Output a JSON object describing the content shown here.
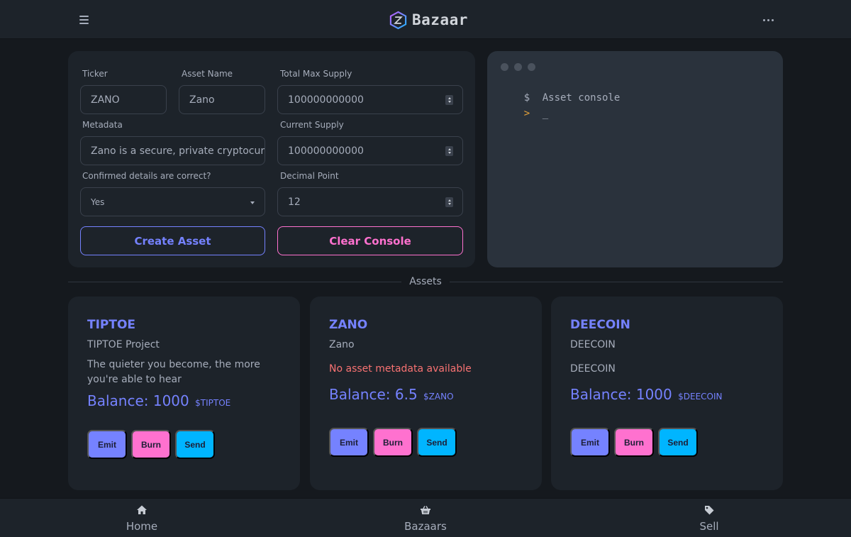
{
  "header": {
    "brand_title": "Bazaar",
    "menu_icon": "hamburger-icon",
    "more_icon": "ellipsis-icon",
    "logo_icon": "zano-hexagon-logo"
  },
  "form": {
    "ticker": {
      "label": "Ticker",
      "value": "ZANO"
    },
    "asset_name": {
      "label": "Asset Name",
      "value": "Zano"
    },
    "total_max_supply": {
      "label": "Total Max Supply",
      "value": "100000000000"
    },
    "metadata": {
      "label": "Metadata",
      "value": "Zano is a secure, private cryptocurrency"
    },
    "current_supply": {
      "label": "Current Supply",
      "value": "100000000000"
    },
    "confirmed": {
      "label": "Confirmed details are correct?",
      "value": "Yes"
    },
    "decimal_point": {
      "label": "Decimal Point",
      "value": "12"
    },
    "create_label": "Create Asset",
    "clear_label": "Clear Console"
  },
  "console": {
    "lines": [
      {
        "prefix": "$",
        "text": "Asset console",
        "prefix_color": "#a6adbb"
      },
      {
        "prefix": ">",
        "text": "_",
        "prefix_color": "#e4a23a"
      }
    ]
  },
  "divider": {
    "label": "Assets"
  },
  "assets": [
    {
      "ticker": "TIPTOE",
      "name": "TIPTOE Project",
      "metadata": "The quieter you become, the more you're able to hear",
      "metadata_missing": false,
      "balance_label": "Balance: 1000",
      "balance_symbol": "$TIPTOE",
      "emit_label": "Emit",
      "burn_label": "Burn",
      "send_label": "Send"
    },
    {
      "ticker": "ZANO",
      "name": "Zano",
      "metadata": "No asset metadata available",
      "metadata_missing": true,
      "balance_label": "Balance: 6.5",
      "balance_symbol": "$ZANO",
      "emit_label": "Emit",
      "burn_label": "Burn",
      "send_label": "Send"
    },
    {
      "ticker": "DEECOIN",
      "name": "DEECOIN",
      "metadata": "DEECOIN",
      "metadata_missing": false,
      "balance_label": "Balance: 1000",
      "balance_symbol": "$DEECOIN",
      "emit_label": "Emit",
      "burn_label": "Burn",
      "send_label": "Send"
    }
  ],
  "bottom_nav": [
    {
      "label": "Home",
      "icon": "home-icon"
    },
    {
      "label": "Bazaars",
      "icon": "basket-icon"
    },
    {
      "label": "Sell",
      "icon": "tag-icon"
    }
  ],
  "colors": {
    "primary": "#7582ff",
    "secondary": "#ff71cf",
    "accent": "#00b5ff",
    "error": "#f87272",
    "card": "#1d232a",
    "background": "#15191e"
  }
}
